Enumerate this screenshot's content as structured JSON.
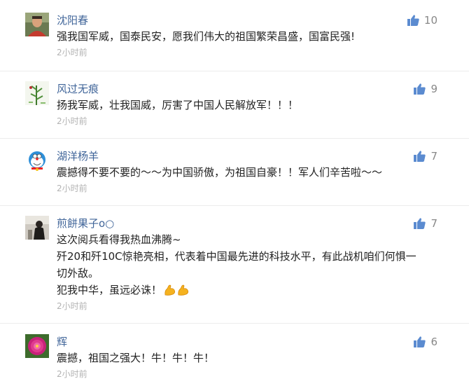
{
  "comments": [
    {
      "username": "沈阳春",
      "likes": "10",
      "lines": [
        "强我国军威，国泰民安，愿我们伟大的祖国繁荣昌盛，国富民强!"
      ],
      "time": "2小时前",
      "avatar": "avatar-man-portrait"
    },
    {
      "username": "风过无痕",
      "likes": "9",
      "lines": [
        "扬我军威，壮我国威，厉害了中国人民解放军！！！"
      ],
      "time": "2小时前",
      "avatar": "avatar-bamboo-painting"
    },
    {
      "username": "湖洋杨羊",
      "likes": "7",
      "lines": [
        "震撼得不要不要的～～为中国骄傲，为祖国自豪！！军人们辛苦啦～～"
      ],
      "time": "2小时前",
      "avatar": "avatar-doraemon"
    },
    {
      "username": "煎餅果子o○",
      "likes": "7",
      "lines": [
        "这次阅兵看得我热血沸腾~",
        "歼20和歼10C惊艳亮相，代表着中国最先进的科技水平，有此战机咱们何惧一",
        "切外敌。",
        "犯我中华，虽远必诛！"
      ],
      "emoji": "flexed-biceps-x2",
      "time": "2小时前",
      "avatar": "avatar-person-photo"
    },
    {
      "username": "辉",
      "likes": "6",
      "lines": [
        "震撼，祖国之强大！牛！牛！牛！"
      ],
      "time": "2小时前",
      "avatar": "avatar-pink-peony"
    }
  ],
  "colors": {
    "username": "#406599",
    "text": "#222222",
    "time": "#b3b3b3",
    "like_icon": "#5b8bd0",
    "like_count": "#888888",
    "separator": "#ececec"
  }
}
